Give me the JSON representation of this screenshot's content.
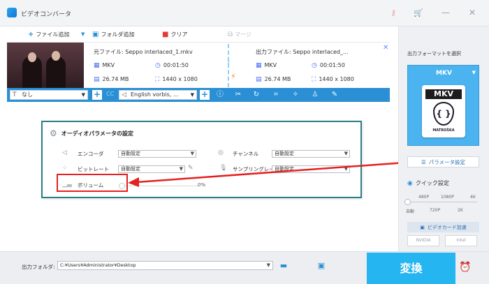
{
  "window": {
    "title": "ビデオコンバータ"
  },
  "toolbar": {
    "add_file": "ファイル追加",
    "add_folder": "フォルダ追加",
    "clear": "クリア",
    "merge": "マージ"
  },
  "file": {
    "source_label": "元ファイル: Seppo interlaced_1.mkv",
    "source_format": "MKV",
    "source_duration": "00:01:50",
    "source_size": "26.74 MB",
    "source_resolution": "1440 x 1080",
    "output_label": "出力ファイル: Seppo interlaced_...",
    "output_format": "MKV",
    "output_duration": "00:01:50",
    "output_size": "26.74 MB",
    "output_resolution": "1440 x 1080"
  },
  "edit_bar": {
    "subtitle_value": "なし",
    "cc_label": "CC",
    "audio_value": "English vorbis, ..."
  },
  "dialog": {
    "title": "オーディオパラメータの設定",
    "encoder_label": "エンコーダ",
    "encoder_value": "自動設定",
    "channel_label": "チャンネル",
    "channel_value": "自動設定",
    "bitrate_label": "ビットレート",
    "bitrate_value": "自動設定",
    "sampling_label": "サンプリングレート",
    "sampling_value": "自動設定",
    "volume_label": "ボリューム",
    "volume_value": "0%",
    "volume_fraction": 0.0
  },
  "right_panel": {
    "title": "出力フォーマットを選択",
    "format": "MKV",
    "format_icon_text": "MKV",
    "format_icon_subtext": "MATROŠKA",
    "param_button": "パラメータ設定",
    "quick_setting": "クイック設定",
    "quality_top": [
      "480P",
      "1080P",
      "4K"
    ],
    "quality_bottom": [
      "自動",
      "720P",
      "2K"
    ],
    "quality_selected": "自動",
    "gpu_label": "ビデオカード加速",
    "gpu_nvidia": "NVIDIA",
    "gpu_intel": "Intel"
  },
  "bottom": {
    "output_folder_label": "出力フォルダ:",
    "output_path": "C:¥Users¥Administrator¥Desktop",
    "convert": "変換"
  },
  "colors": {
    "accent": "#2a8fd4",
    "convert_bg": "#25b5f0",
    "format_box": "#4ab3f0",
    "dialog_border": "#2b7f86",
    "highlight_red": "#e52020",
    "bolt": "#ff8a00"
  }
}
